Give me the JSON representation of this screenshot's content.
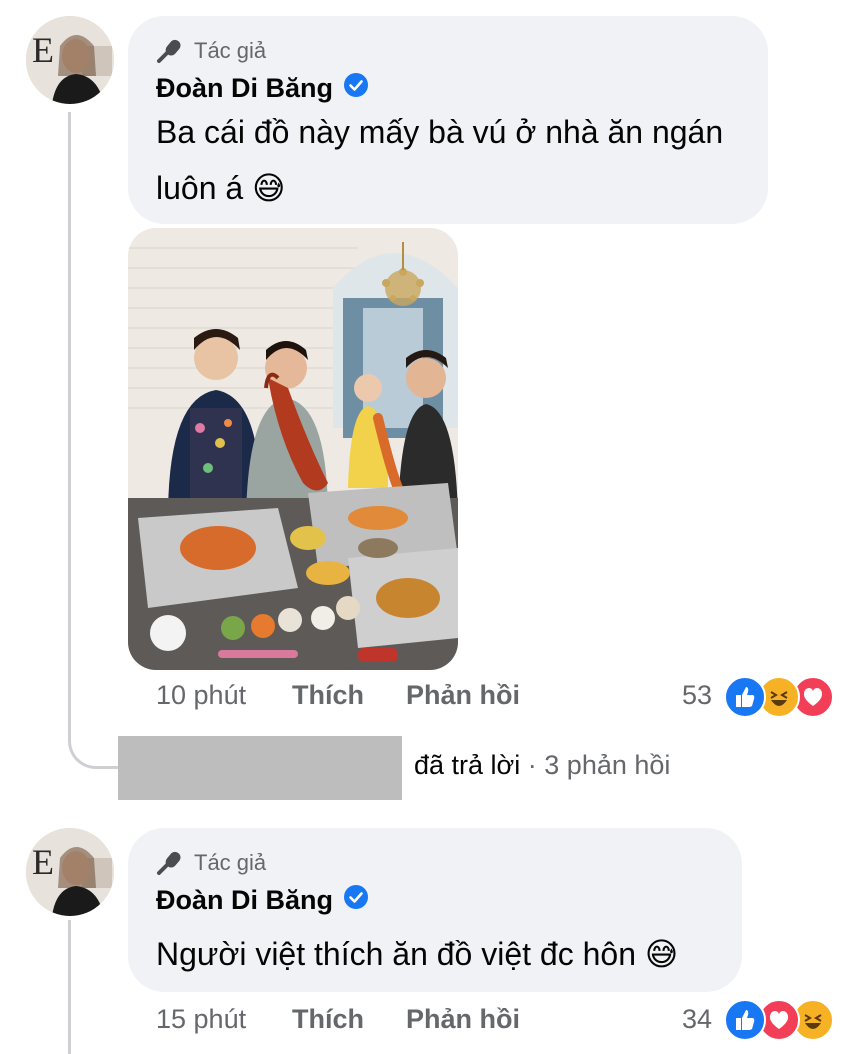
{
  "comments": [
    {
      "badge": "Tác giả",
      "author": "Đoàn Di Băng",
      "text_line1": "Ba cái đồ này mấy bà vú ở nhà ăn ngán",
      "text_line2": "luôn á",
      "emoji": "😅",
      "time": "10 phút",
      "like": "Thích",
      "reply": "Phản hồi",
      "reaction_count": "53",
      "reactions": [
        "like-icon",
        "haha-icon",
        "love-icon"
      ],
      "photo_icon": "family-seafood-photo"
    },
    {
      "badge": "Tác giả",
      "author": "Đoàn Di Băng",
      "text_line1": "Người việt thích ăn đồ việt đc hôn",
      "emoji": "😅",
      "time": "15 phút",
      "like": "Thích",
      "reply": "Phản hồi",
      "reaction_count": "34",
      "reactions": [
        "like-icon",
        "love-icon",
        "haha-icon"
      ]
    }
  ],
  "replies_summary": {
    "text": "đã trả lời",
    "separator": "·",
    "count": "3 phản hồi"
  },
  "colors": {
    "bubble": "#f0f2f5",
    "meta": "#65676b",
    "verified": "#1877f2",
    "like": "#1877f2",
    "love": "#f33e58",
    "haha": "#f7b125"
  }
}
